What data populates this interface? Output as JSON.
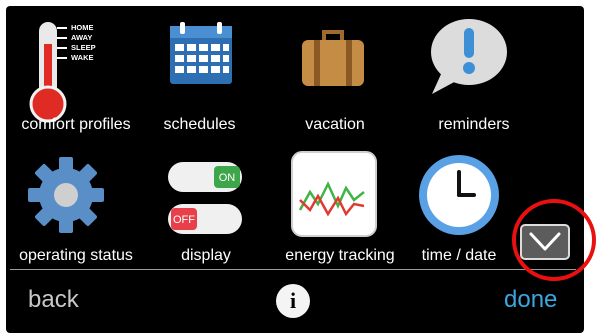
{
  "menu": {
    "row1": [
      {
        "label": "comfort profiles",
        "icon": "thermometer-icon"
      },
      {
        "label": "schedules",
        "icon": "calendar-icon"
      },
      {
        "label": "vacation",
        "icon": "suitcase-icon"
      },
      {
        "label": "reminders",
        "icon": "speech-bubble-exclamation-icon"
      }
    ],
    "row2": [
      {
        "label": "operating status",
        "icon": "gear-icon"
      },
      {
        "label": "display",
        "icon": "toggle-switches-icon"
      },
      {
        "label": "energy tracking",
        "icon": "line-graph-icon"
      },
      {
        "label": "time / date",
        "icon": "clock-icon"
      }
    ],
    "thermometer_modes": [
      "HOME",
      "AWAY",
      "SLEEP",
      "WAKE"
    ],
    "toggle_on": "ON",
    "toggle_off": "OFF"
  },
  "nav": {
    "back_label": "back",
    "done_label": "done",
    "info_glyph": "i",
    "scroll_icon": "chevron-down-icon"
  },
  "colors": {
    "background": "#000000",
    "text": "#ffffff",
    "accent_done": "#3aa7df",
    "back_gray": "#c8c8c8",
    "highlight_circle": "#e81010"
  }
}
